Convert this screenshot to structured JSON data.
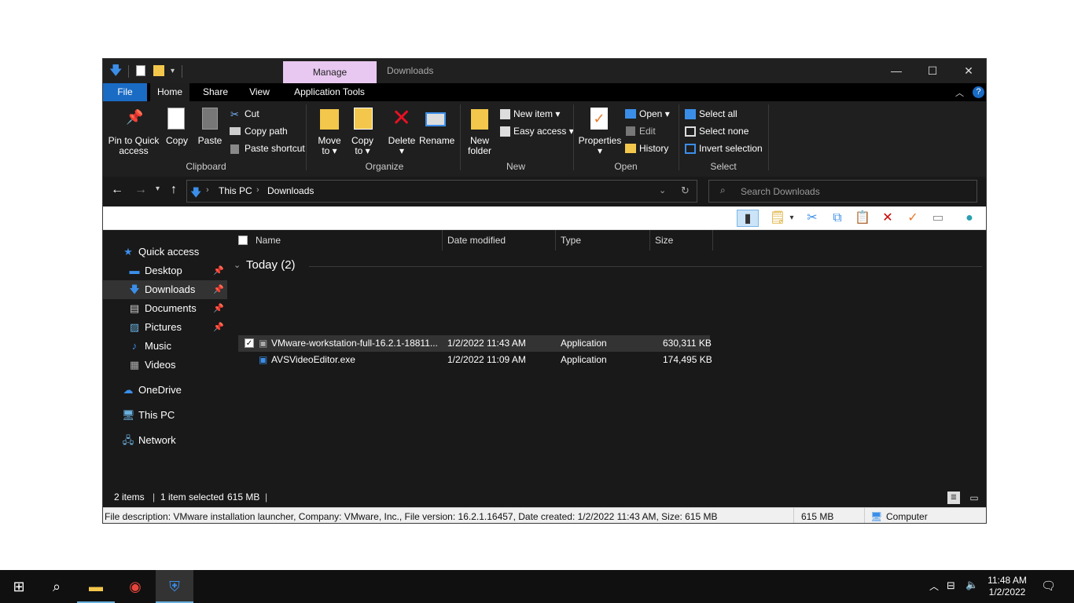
{
  "window": {
    "title": "Downloads",
    "manage_tab": "Manage",
    "tabs": [
      "File",
      "Home",
      "Share",
      "View",
      "Application Tools"
    ]
  },
  "ribbon": {
    "clipboard": {
      "pin": "Pin to Quick",
      "pin2": "access",
      "copy": "Copy",
      "paste": "Paste",
      "cut": "Cut",
      "copy_path": "Copy path",
      "paste_shortcut": "Paste shortcut",
      "group": "Clipboard"
    },
    "organize": {
      "move": "Move",
      "move2": "to",
      "copy": "Copy",
      "copy2": "to",
      "delete": "Delete",
      "rename": "Rename",
      "group": "Organize"
    },
    "new": {
      "new_folder": "New",
      "new_folder2": "folder",
      "new_item": "New item",
      "easy_access": "Easy access",
      "group": "New"
    },
    "open": {
      "properties": "Properties",
      "open": "Open",
      "edit": "Edit",
      "history": "History",
      "group": "Open"
    },
    "select": {
      "select_all": "Select all",
      "select_none": "Select none",
      "invert": "Invert selection",
      "group": "Select"
    }
  },
  "address": {
    "crumb1": "This PC",
    "crumb2": "Downloads",
    "search_placeholder": "Search Downloads"
  },
  "nav": {
    "quick_access": "Quick access",
    "items": [
      "Desktop",
      "Downloads",
      "Documents",
      "Pictures",
      "Music",
      "Videos"
    ],
    "onedrive": "OneDrive",
    "thispc": "This PC",
    "network": "Network"
  },
  "columns": {
    "name": "Name",
    "date": "Date modified",
    "type": "Type",
    "size": "Size"
  },
  "group_header": "Today (2)",
  "files": [
    {
      "name": "VMware-workstation-full-16.2.1-18811...",
      "date": "1/2/2022 11:43 AM",
      "type": "Application",
      "size": "630,311 KB"
    },
    {
      "name": "AVSVideoEditor.exe",
      "date": "1/2/2022 11:09 AM",
      "type": "Application",
      "size": "174,495 KB"
    }
  ],
  "status": {
    "items": "2 items",
    "selected": "1 item selected",
    "size": "615 MB"
  },
  "descbar": {
    "desc": "File description: VMware installation launcher, Company: VMware, Inc., File version: 16.2.1.16457, Date created: 1/2/2022 11:43 AM, Size: 615 MB",
    "size": "615 MB",
    "location": "Computer"
  },
  "taskbar": {
    "time": "11:48 AM",
    "date": "1/2/2022"
  }
}
